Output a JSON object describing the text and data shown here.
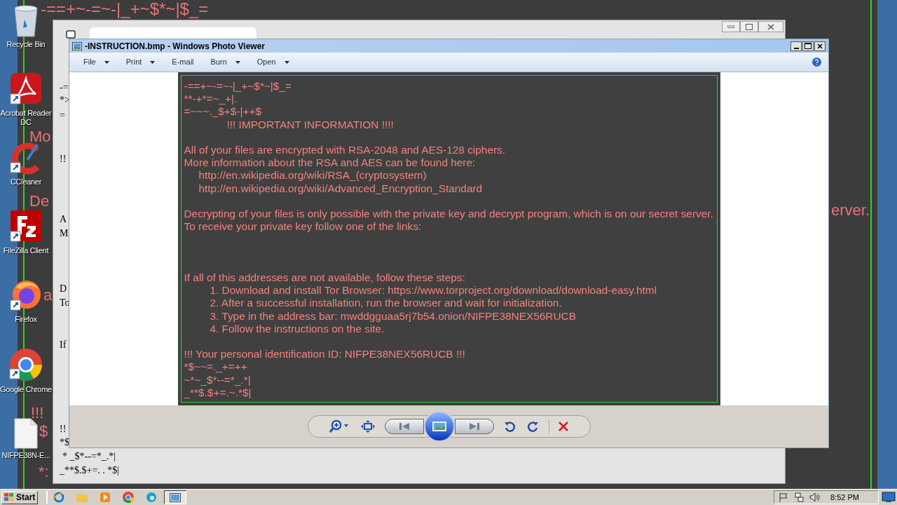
{
  "desktop": {
    "wallpaper_text": [
      "-==+~-=~-|_+~$*~|$_=",
      "Mo",
      "De",
      "a",
      "!!!",
      "$",
      "*:",
      "erver."
    ],
    "icons": [
      {
        "label": "Recycle Bin",
        "kind": "recycle"
      },
      {
        "label": "Acrobat Reader DC",
        "kind": "acrobat"
      },
      {
        "label": "CCleaner",
        "kind": "ccleaner"
      },
      {
        "label": "FileZilla Client",
        "kind": "filezilla"
      },
      {
        "label": "Firefox",
        "kind": "firefox"
      },
      {
        "label": "Google Chrome",
        "kind": "chrome"
      },
      {
        "label": "NIFPE38N-E...",
        "kind": "file"
      }
    ]
  },
  "browser_window": {
    "page_fragments": [
      "-=",
      "*>",
      "=",
      "!!",
      "A",
      "M",
      "D",
      "To",
      "If",
      "!!",
      "*$",
      "* _$*--=*_.*|",
      "_**$.$+=. . *$|"
    ]
  },
  "photo_viewer": {
    "title": "-INSTRUCTION.bmp - Windows Photo Viewer",
    "menu": [
      {
        "label": "File",
        "dropdown": true
      },
      {
        "label": "Print",
        "dropdown": true
      },
      {
        "label": "E-mail",
        "dropdown": false
      },
      {
        "label": "Burn",
        "dropdown": true
      },
      {
        "label": "Open",
        "dropdown": true
      }
    ],
    "image_text": [
      {
        "kind": "plain",
        "text": "-==+~-=~-|_+~$*~|$_="
      },
      {
        "kind": "plain",
        "text": "**-+*=~_+|."
      },
      {
        "kind": "plain",
        "text": "=~~~._$+$-|++$"
      },
      {
        "kind": "heading",
        "text": "!!! IMPORTANT INFORMATION !!!!"
      },
      {
        "kind": "blank"
      },
      {
        "kind": "plain",
        "text": "All of your files are encrypted with RSA-2048 and AES-128 ciphers."
      },
      {
        "kind": "plain",
        "text": "More information about the RSA and AES can be found here:"
      },
      {
        "kind": "link",
        "text": "http://en.wikipedia.org/wiki/RSA_(cryptosystem)"
      },
      {
        "kind": "link",
        "text": "http://en.wikipedia.org/wiki/Advanced_Encryption_Standard"
      },
      {
        "kind": "blank"
      },
      {
        "kind": "plain",
        "text": "Decrypting of your files is only possible with the private key and decrypt program, which is on our secret server."
      },
      {
        "kind": "plain",
        "text": "To receive your private key follow one of the links:"
      },
      {
        "kind": "blank"
      },
      {
        "kind": "blank"
      },
      {
        "kind": "blank"
      },
      {
        "kind": "plain",
        "text": "If all of this addresses are not available, follow these steps:"
      },
      {
        "kind": "step",
        "text": "1. Download and install Tor Browser: https://www.torproject.org/download/download-easy.html"
      },
      {
        "kind": "step",
        "text": "2. After a successful installation, run the browser and wait for initialization."
      },
      {
        "kind": "step",
        "text": "3. Type in the address bar: mwddgguaa5rj7b54.onion/NIFPE38NEX56RUCB"
      },
      {
        "kind": "step",
        "text": "4. Follow the instructions on the site."
      },
      {
        "kind": "blank"
      },
      {
        "kind": "plain",
        "text": "!!! Your personal identification ID: NIFPE38NEX56RUCB !!!"
      },
      {
        "kind": "plain",
        "text": "*$~~=._+=++"
      },
      {
        "kind": "plain",
        "text": "~*~_$*--=*_.*|"
      },
      {
        "kind": "plain",
        "text": "_**$.$+=.~.*$|"
      }
    ]
  },
  "taskbar": {
    "start": "Start",
    "clock": "8:52 PM"
  }
}
